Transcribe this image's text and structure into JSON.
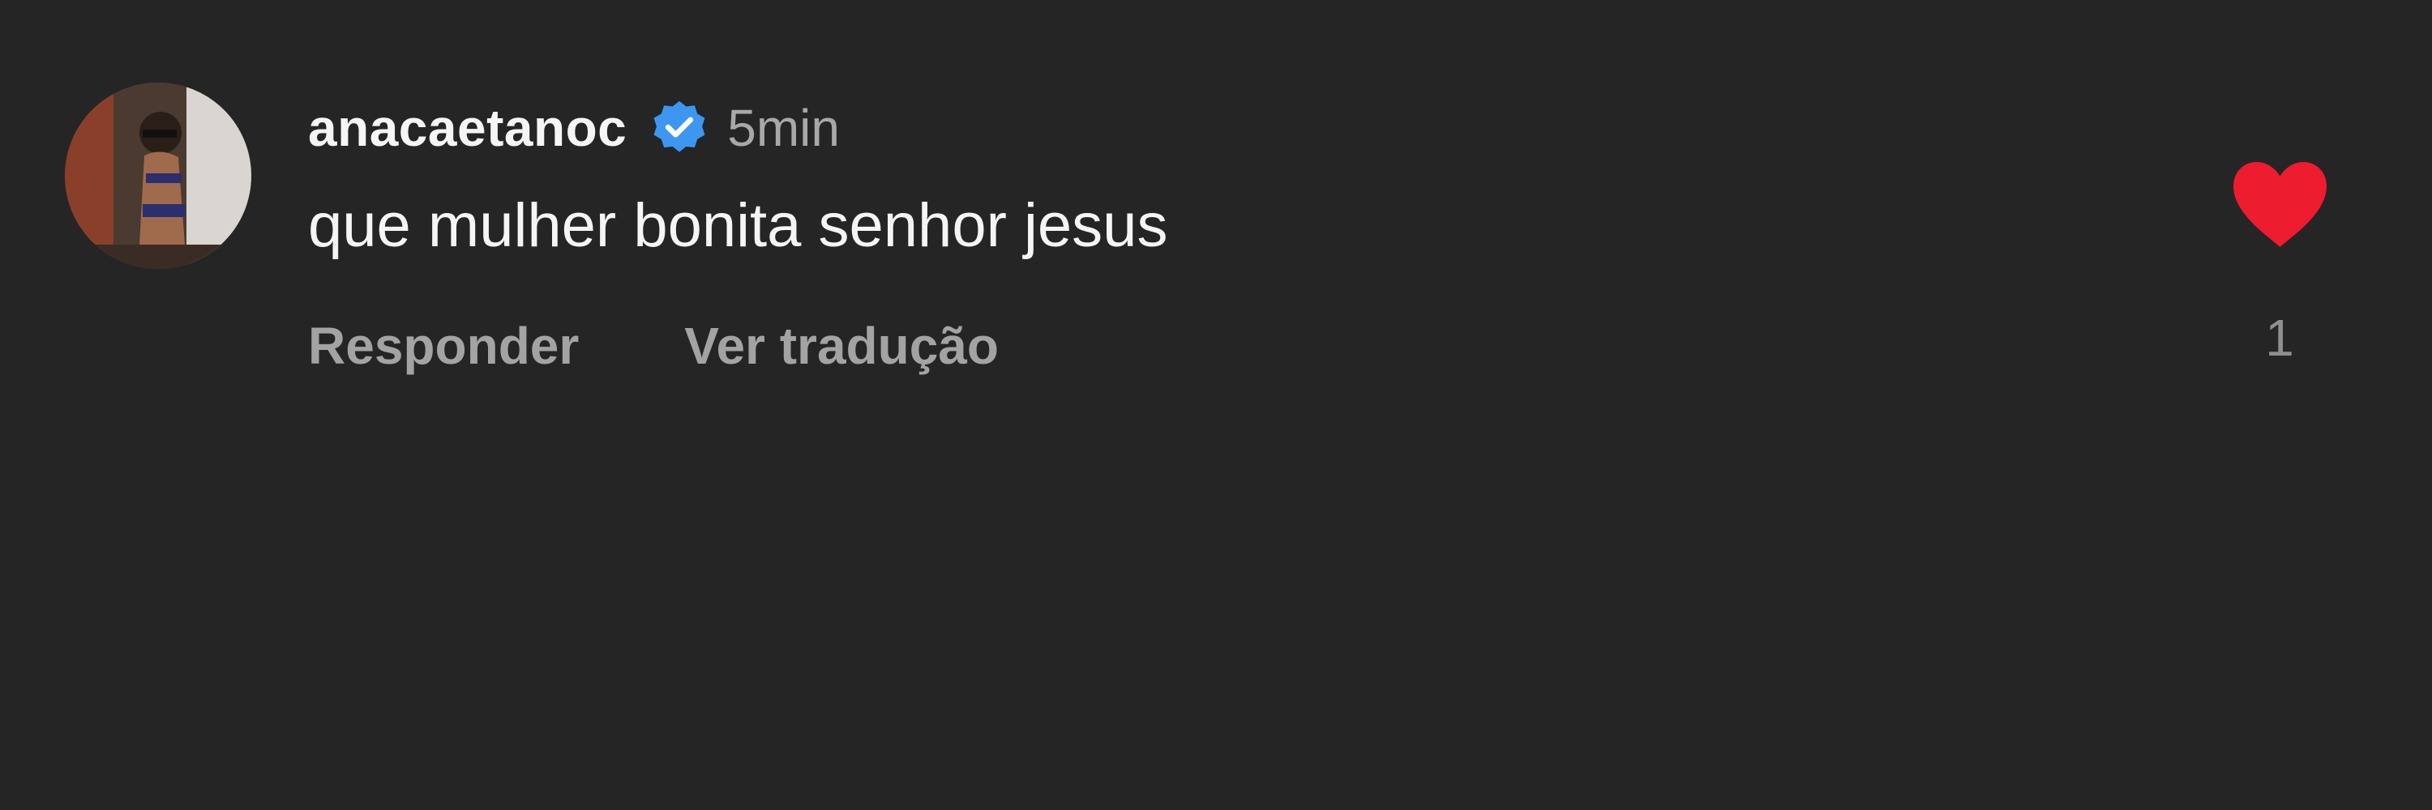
{
  "comment": {
    "username": "anacaetanoc",
    "verified_icon": "verified-badge-icon",
    "time": "5min",
    "text": "que mulher bonita senhor jesus",
    "actions": {
      "reply_label": "Responder",
      "translate_label": "Ver tradução"
    },
    "like": {
      "icon": "heart-icon",
      "liked": true,
      "color": "#ed1c2e",
      "count": "1"
    }
  },
  "colors": {
    "background": "#252525",
    "verified": "#3d96f0",
    "secondary_text": "#a8a8a8"
  }
}
